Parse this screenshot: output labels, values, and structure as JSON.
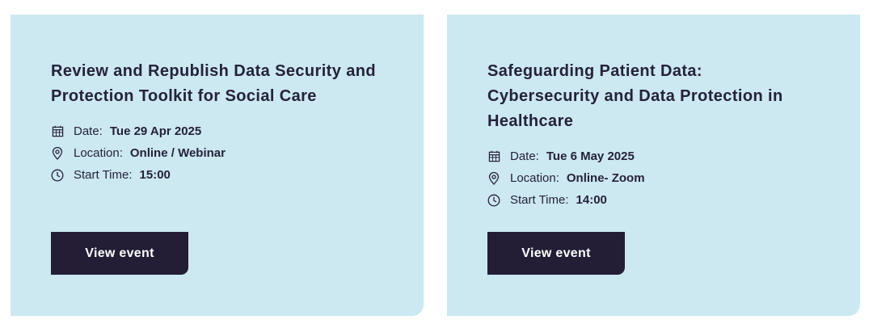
{
  "events": [
    {
      "title": "Review and Republish Data Security and Protection Toolkit for Social Care",
      "date_label": "Date:",
      "date_value": "Tue 29 Apr 2025",
      "location_label": "Location:",
      "location_value": "Online / Webinar",
      "time_label": "Start Time:",
      "time_value": "15:00",
      "button_label": "View event"
    },
    {
      "title": "Safeguarding Patient Data: Cybersecurity and Data Protection in Healthcare",
      "date_label": "Date:",
      "date_value": "Tue 6 May 2025",
      "location_label": "Location:",
      "location_value": "Online- Zoom",
      "time_label": "Start Time:",
      "time_value": "14:00",
      "button_label": "View event"
    }
  ],
  "icons": {
    "date": "calendar-icon",
    "location": "map-pin-icon",
    "time": "clock-icon"
  },
  "colors": {
    "card_background": "#cce8f1",
    "text": "#25223a",
    "button_background": "#231e36",
    "button_text": "#ffffff"
  }
}
